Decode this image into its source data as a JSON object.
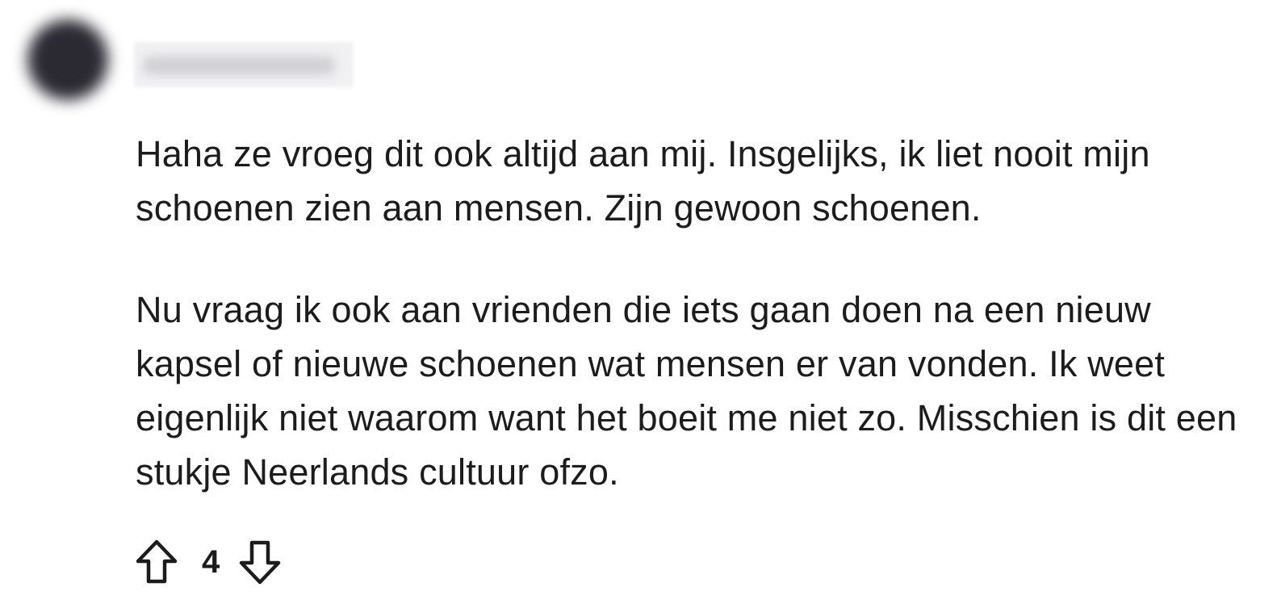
{
  "comment": {
    "author": "",
    "paragraphs": [
      "Haha ze vroeg dit ook altijd aan mij. Insgelijks, ik liet nooit mijn schoenen zien aan mensen. Zijn gewoon schoenen.",
      "Nu vraag ik ook aan vrienden die iets gaan doen na een nieuw kapsel of nieuwe schoenen wat mensen er van vonden. Ik weet eigenlijk niet waarom want het boeit me niet zo. Misschien is dit een stukje Neerlands cultuur ofzo."
    ],
    "score": "4"
  },
  "icons": {
    "upvote": "arrow-up-outline-icon",
    "downvote": "arrow-down-outline-icon"
  },
  "colors": {
    "text": "#1c1c1c",
    "avatar": "#2b2a33",
    "background": "#ffffff"
  }
}
